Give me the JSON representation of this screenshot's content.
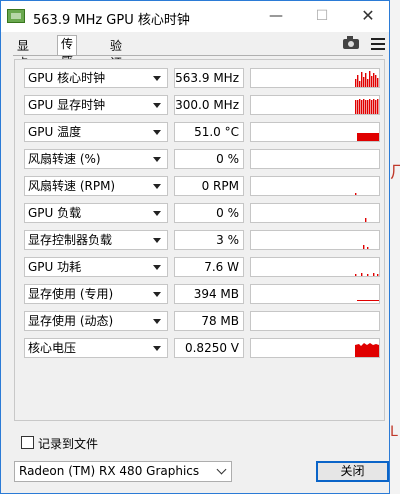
{
  "window": {
    "title": "563.9 MHz GPU 核心时钟",
    "close_glyph": "✕",
    "minimize_glyph": "—",
    "maximize_glyph": "☐"
  },
  "tabs": [
    {
      "label": "显卡"
    },
    {
      "label": "传感器",
      "active": true
    },
    {
      "label": "验证"
    }
  ],
  "toolbar": {
    "icons": [
      "camera-icon",
      "menu-icon"
    ]
  },
  "sensors": [
    {
      "label": "GPU 核心时钟",
      "value": "563.9 MHz"
    },
    {
      "label": "GPU 显存时钟",
      "value": "300.0 MHz"
    },
    {
      "label": "GPU 温度",
      "value": "51.0 °C"
    },
    {
      "label": "风扇转速 (%)",
      "value": "0 %"
    },
    {
      "label": "风扇转速 (RPM)",
      "value": "0 RPM"
    },
    {
      "label": "GPU 负载",
      "value": "0 %"
    },
    {
      "label": "显存控制器负载",
      "value": "3 %"
    },
    {
      "label": "GPU 功耗",
      "value": "7.6 W"
    },
    {
      "label": "显存使用 (专用)",
      "value": "394 MB"
    },
    {
      "label": "显存使用 (动态)",
      "value": "78 MB"
    },
    {
      "label": "核心电压",
      "value": "0.8250 V"
    }
  ],
  "footer": {
    "log_to_file_label": "记录到文件",
    "log_to_file_checked": false,
    "gpu_selected": "Radeon (TM) RX 480 Graphics",
    "close_label": "关闭"
  },
  "colors": {
    "graph": "#e00000",
    "accent": "#0a64c8"
  }
}
